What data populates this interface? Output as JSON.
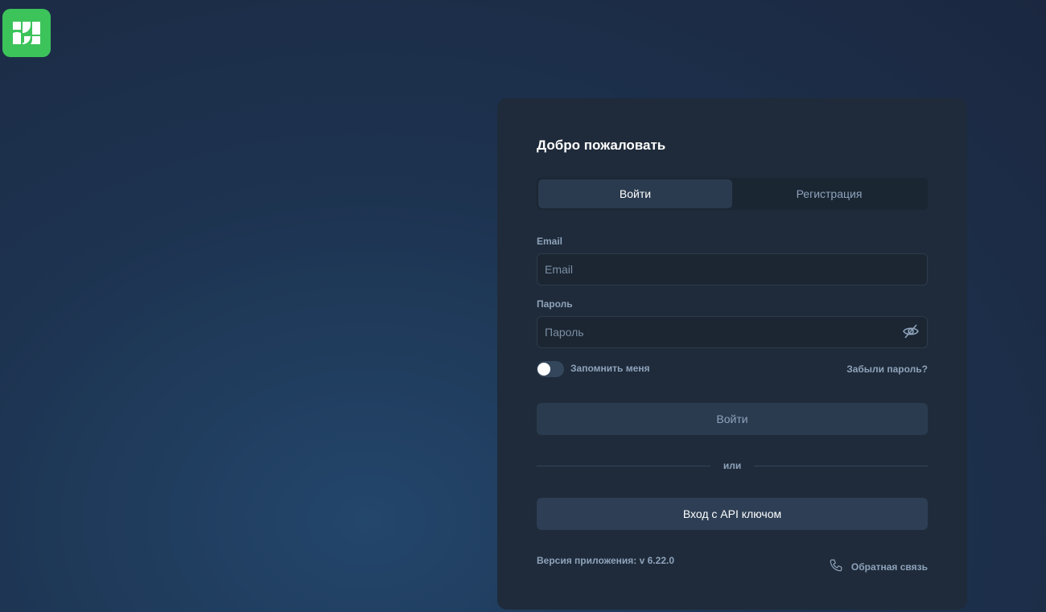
{
  "title": "Добро пожаловать",
  "tabs": [
    {
      "label": "Войти"
    },
    {
      "label": "Регистрация"
    }
  ],
  "email": {
    "label": "Email",
    "placeholder": "Email"
  },
  "password": {
    "label": "Пароль",
    "placeholder": "Пароль"
  },
  "remember": "Запомнить меня",
  "forgot": "Забыли пароль?",
  "login_button": "Войти",
  "separator": "или",
  "api_button": "Вход с API ключом",
  "version": "Версия приложения: v 6.22.0",
  "feedback": "Обратная связь"
}
